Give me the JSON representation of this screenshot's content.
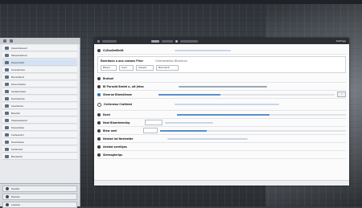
{
  "window": {
    "title": "Settings",
    "rows": [
      {
        "label": "CLEanSetEntit",
        "value": "",
        "bullet": "dark"
      },
      {
        "label": "Ewerdaon a ana cowons Prior",
        "value": "Creemadetton Bheadcan",
        "bullet": "dark"
      },
      {
        "label": "Bratoel",
        "value": "",
        "bullet": "dark"
      },
      {
        "label": "Bl Porasid Bratel a, alt Jetos",
        "value": "",
        "bullet": "dark"
      },
      {
        "label": "Steeroe Bheedlease",
        "value": "",
        "bullet": "blue"
      },
      {
        "label": "Cerleneoo Cratteed",
        "value": "",
        "bullet": "hollow"
      },
      {
        "label": "Eaed",
        "value": "",
        "bullet": "dark"
      },
      {
        "label": "Neal Blaerteeming",
        "value": "",
        "bullet": "dark"
      },
      {
        "label": "Blew aeel",
        "value": "",
        "bullet": "dark"
      },
      {
        "label": "Neelad lat Neeleeide",
        "value": "",
        "bullet": "dark"
      },
      {
        "label": "Aeeled sereliges",
        "value": "",
        "bullet": "dark"
      },
      {
        "label": "Sleesaglerlgs",
        "value": "",
        "bullet": "dark"
      }
    ],
    "fields": [
      "Bleed",
      "Ioed",
      "Sleeed",
      "Bemdent"
    ],
    "sliders": [
      0.35,
      0.55,
      0.25
    ]
  },
  "sidebar": {
    "items": [
      "Qeesideaeed",
      "Pelseededsre",
      "Deaersteld",
      "Slnedertesl",
      "Benadeled",
      "Dleerdleelie",
      "Sedeerteele",
      "Dedelselde",
      "Seederele",
      "Beeded",
      "Sleeseeeleed",
      "Deeedelee",
      "Ledeeeled",
      "Deedselee",
      "Sederede",
      "Beeleede"
    ],
    "buttons": [
      "Seeele",
      "Deeele",
      "Leeede"
    ]
  },
  "colors": {
    "accent": "#2f6db3",
    "titlebar": "#2b2f34"
  }
}
